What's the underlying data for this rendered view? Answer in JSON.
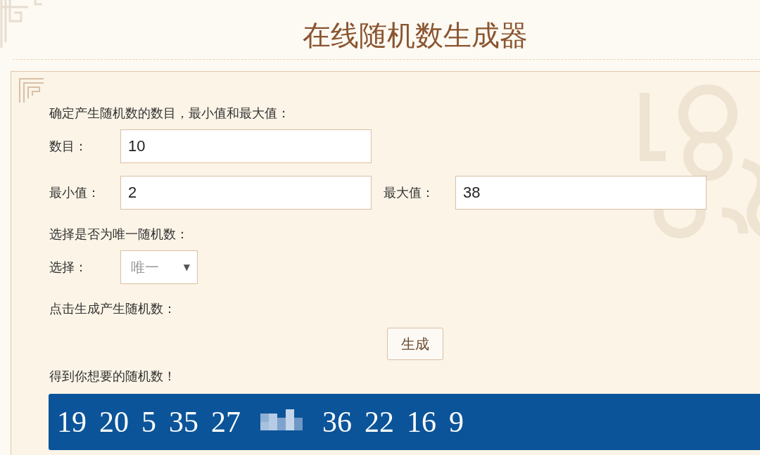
{
  "title": "在线随机数生成器",
  "intro": "确定产生随机数的数目，最小值和最大值：",
  "count_field": {
    "label": "数目：",
    "value": "10"
  },
  "min_field": {
    "label": "最小值：",
    "value": "2"
  },
  "max_field": {
    "label": "最大值：",
    "value": "38"
  },
  "unique_prompt": "选择是否为唯一随机数：",
  "select": {
    "label": "选择：",
    "value": "唯一",
    "caret": "▼"
  },
  "generate_prompt": "点击生成产生随机数：",
  "generate_button": "生成",
  "result_prompt": "得到你想要的随机数！",
  "results": [
    {
      "kind": "number",
      "text": "19"
    },
    {
      "kind": "number",
      "text": "20"
    },
    {
      "kind": "number",
      "text": "5"
    },
    {
      "kind": "number",
      "text": "35"
    },
    {
      "kind": "number",
      "text": "27"
    },
    {
      "kind": "obscured"
    },
    {
      "kind": "number",
      "text": "36"
    },
    {
      "kind": "number",
      "text": "22"
    },
    {
      "kind": "number",
      "text": "16"
    },
    {
      "kind": "number",
      "text": "9"
    }
  ]
}
